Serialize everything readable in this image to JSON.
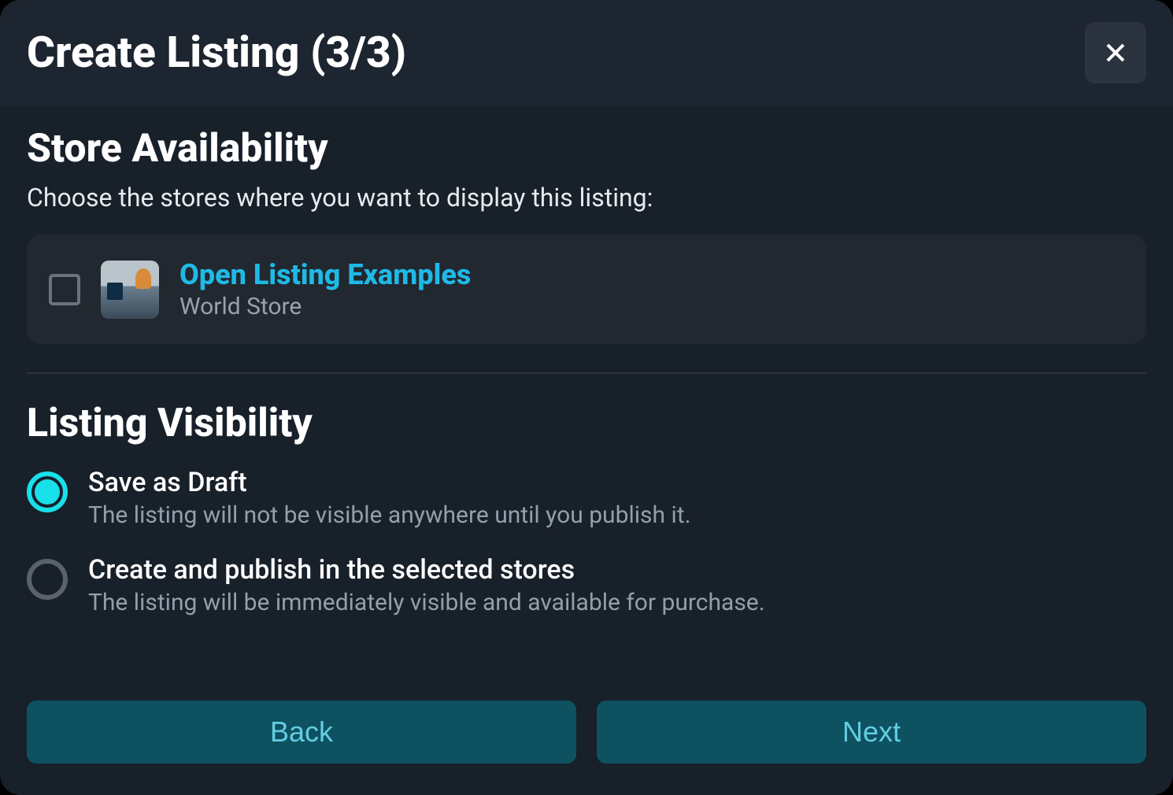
{
  "header": {
    "title": "Create Listing (3/3)"
  },
  "store_availability": {
    "heading": "Store Availability",
    "subheading": "Choose the stores where you want to display this listing:",
    "stores": [
      {
        "name": "Open Listing Examples",
        "type": "World Store",
        "checked": false
      }
    ]
  },
  "listing_visibility": {
    "heading": "Listing Visibility",
    "options": [
      {
        "title": "Save as Draft",
        "description": "The listing will not be visible anywhere until you publish it.",
        "selected": true
      },
      {
        "title": "Create and publish in the selected stores",
        "description": "The listing will be immediately visible and available for purchase.",
        "selected": false
      }
    ]
  },
  "footer": {
    "back_label": "Back",
    "next_label": "Next"
  }
}
